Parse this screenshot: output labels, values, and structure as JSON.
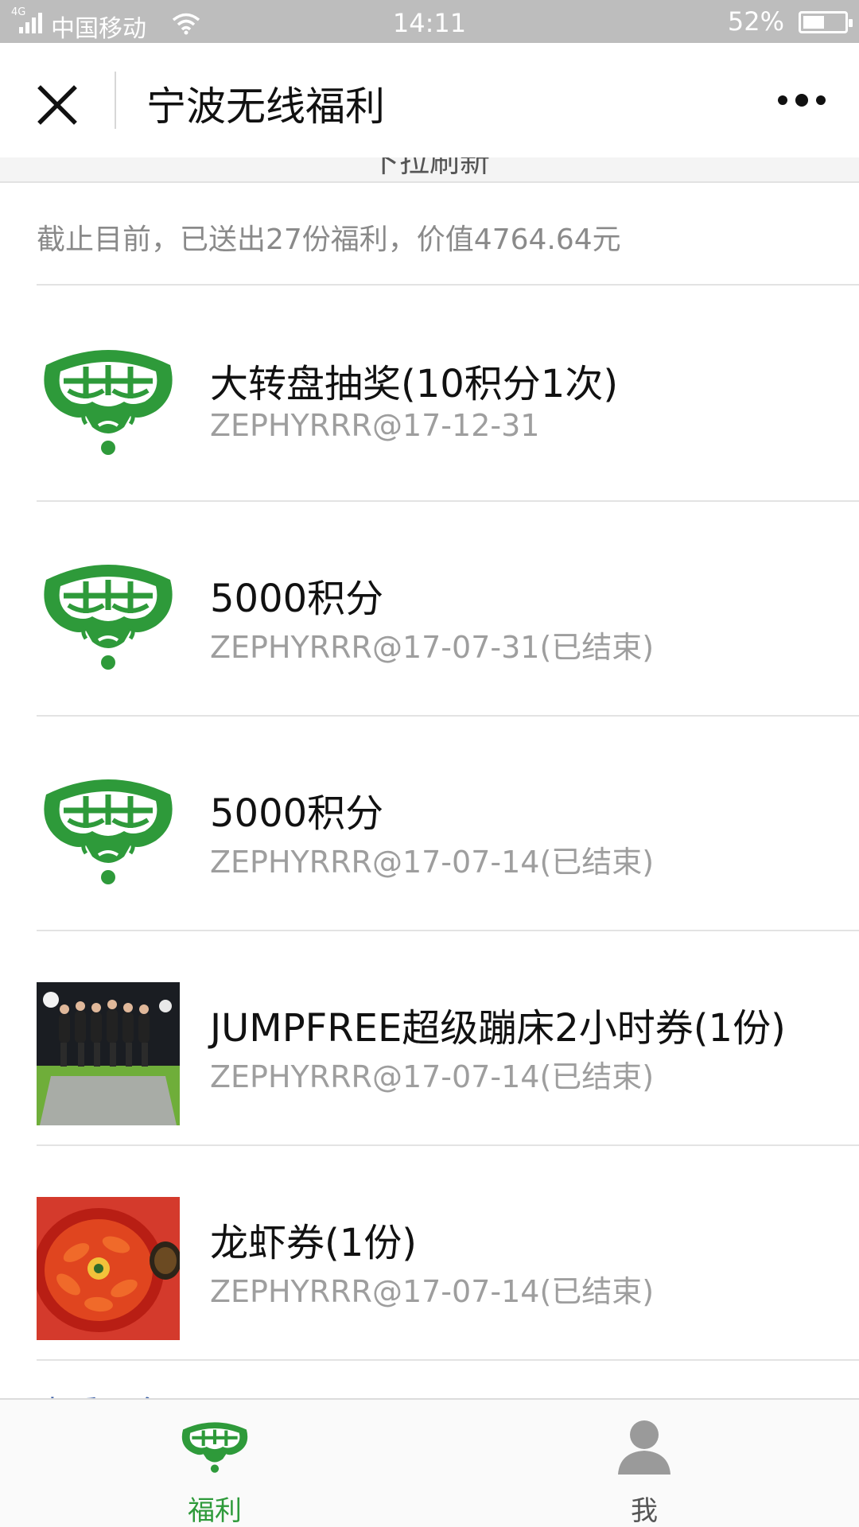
{
  "status_bar": {
    "network": "4G",
    "carrier": "中国移动",
    "time": "14:11",
    "battery_text": "52%",
    "battery_level": 0.52
  },
  "nav": {
    "title": "宁波无线福利",
    "close_icon": "close-icon",
    "more_icon": "more-dots-icon"
  },
  "refresh_hint": "下拉刷新",
  "summary": "截止目前，已送出27份福利，价值4764.64元",
  "items": [
    {
      "title": "大转盘抽奖(10积分1次)",
      "meta": "ZEPHYRRR@17-12-31",
      "thumb": "green-logo"
    },
    {
      "title": "5000积分",
      "meta": "ZEPHYRRR@17-07-31(已结束)",
      "thumb": "green-logo"
    },
    {
      "title": "5000积分",
      "meta": "ZEPHYRRR@17-07-14(已结束)",
      "thumb": "green-logo"
    },
    {
      "title": "JUMPFREE超级蹦床2小时券(1份)",
      "meta": "ZEPHYRRR@17-07-14(已结束)",
      "thumb": "trampoline-photo"
    },
    {
      "title": "龙虾券(1份)",
      "meta": "ZEPHYRRR@17-07-14(已结束)",
      "thumb": "crayfish-photo"
    }
  ],
  "more_link": "查看更多",
  "tabs": [
    {
      "label": "福利",
      "icon": "green-logo-icon",
      "active": true
    },
    {
      "label": "我",
      "icon": "person-icon",
      "active": false
    }
  ],
  "colors": {
    "brand_green": "#2e9a3a",
    "status_bar_bg": "#bdbdbd",
    "meta_text": "#9e9e9e"
  }
}
